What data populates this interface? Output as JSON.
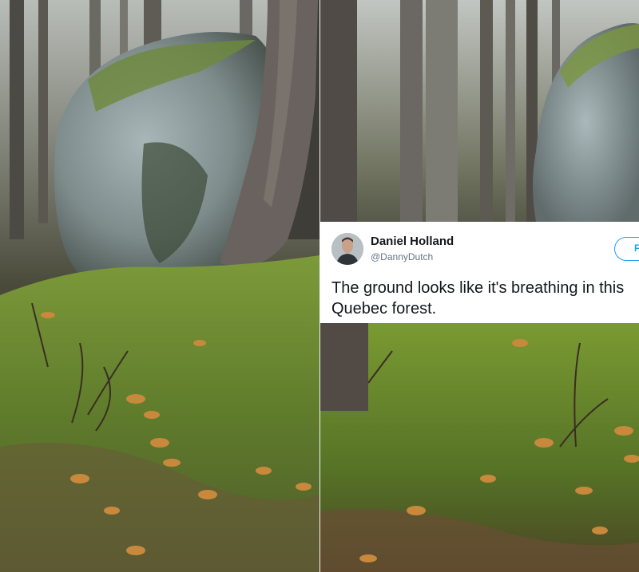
{
  "tweet": {
    "author_name": "Daniel Holland",
    "author_handle": "@DannyDutch",
    "follow_label": "F",
    "text": "The ground looks like it's breathing in this Quebec forest."
  },
  "scene": {
    "moss_color": "#5e7a2e",
    "rock_color": "#8c9c9e",
    "trunk_color": "#5a504c",
    "leaf_color": "#c8893c"
  }
}
